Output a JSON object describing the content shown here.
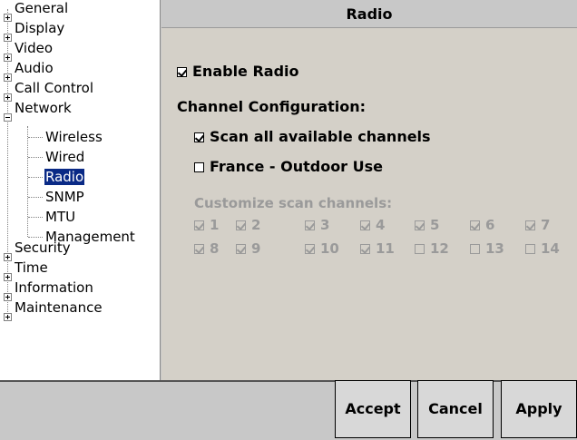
{
  "tree": {
    "items": [
      {
        "label": "General",
        "expander": "plus"
      },
      {
        "label": "Display",
        "expander": "plus"
      },
      {
        "label": "Video",
        "expander": "plus"
      },
      {
        "label": "Audio",
        "expander": "plus"
      },
      {
        "label": "Call Control",
        "expander": "plus"
      },
      {
        "label": "Network",
        "expander": "minus"
      },
      {
        "label": "Wireless"
      },
      {
        "label": "Wired"
      },
      {
        "label": "Radio",
        "selected": true
      },
      {
        "label": "SNMP"
      },
      {
        "label": "MTU"
      },
      {
        "label": "Management"
      },
      {
        "label": "Security",
        "expander": "plus"
      },
      {
        "label": "Time",
        "expander": "plus"
      },
      {
        "label": "Information",
        "expander": "plus"
      },
      {
        "label": "Maintenance",
        "expander": "plus"
      }
    ]
  },
  "panel": {
    "title": "Radio",
    "enable_radio": {
      "label": "Enable Radio",
      "checked": true
    },
    "channel_config_heading": "Channel Configuration:",
    "scan_all": {
      "label": "Scan all available channels",
      "checked": true
    },
    "france_outdoor": {
      "label": "France - Outdoor Use",
      "checked": false
    },
    "customize_heading": "Customize scan channels:",
    "channels": [
      {
        "label": "1",
        "checked": true
      },
      {
        "label": "2",
        "checked": true
      },
      {
        "label": "3",
        "checked": true
      },
      {
        "label": "4",
        "checked": true
      },
      {
        "label": "5",
        "checked": true
      },
      {
        "label": "6",
        "checked": true
      },
      {
        "label": "7",
        "checked": true
      },
      {
        "label": "8",
        "checked": true
      },
      {
        "label": "9",
        "checked": true
      },
      {
        "label": "10",
        "checked": true
      },
      {
        "label": "11",
        "checked": true
      },
      {
        "label": "12",
        "checked": false
      },
      {
        "label": "13",
        "checked": false
      },
      {
        "label": "14",
        "checked": false
      }
    ]
  },
  "buttons": {
    "accept": "Accept",
    "cancel": "Cancel",
    "apply": "Apply"
  },
  "colors": {
    "selection": "#0a2a86",
    "disabled_text": "#9a9a9a"
  }
}
